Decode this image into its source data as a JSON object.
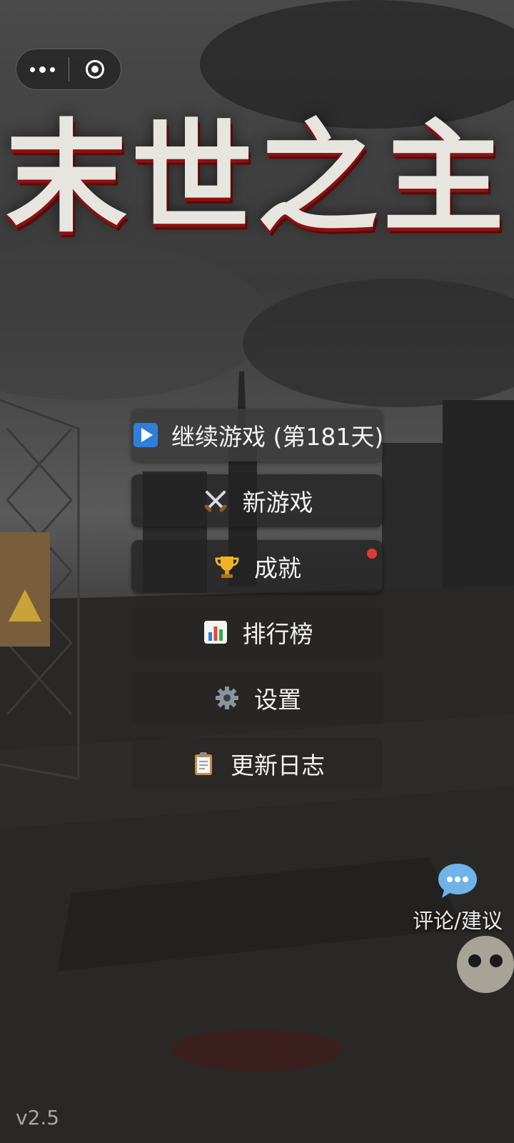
{
  "capsule": {
    "more_icon": "more-dots-icon",
    "close_icon": "target-close-icon"
  },
  "title": "末世之主",
  "menu": {
    "continue_label": "继续游戏 (第181天)",
    "new_game_label": "新游戏",
    "achievements_label": "成就",
    "leaderboard_label": "排行榜",
    "settings_label": "设置",
    "changelog_label": "更新日志"
  },
  "icons": {
    "continue": "play-icon",
    "new_game": "crossed-swords-icon",
    "achievements": "trophy-icon",
    "leaderboard": "bar-chart-icon",
    "settings": "gear-icon",
    "changelog": "clipboard-icon",
    "comment": "speech-bubble-icon"
  },
  "comment_label": "评论/建议",
  "version": "v2.5",
  "colors": {
    "badge": "#e53935",
    "title_shadow": "#8a1212",
    "play_icon": "#2f7fd8"
  }
}
